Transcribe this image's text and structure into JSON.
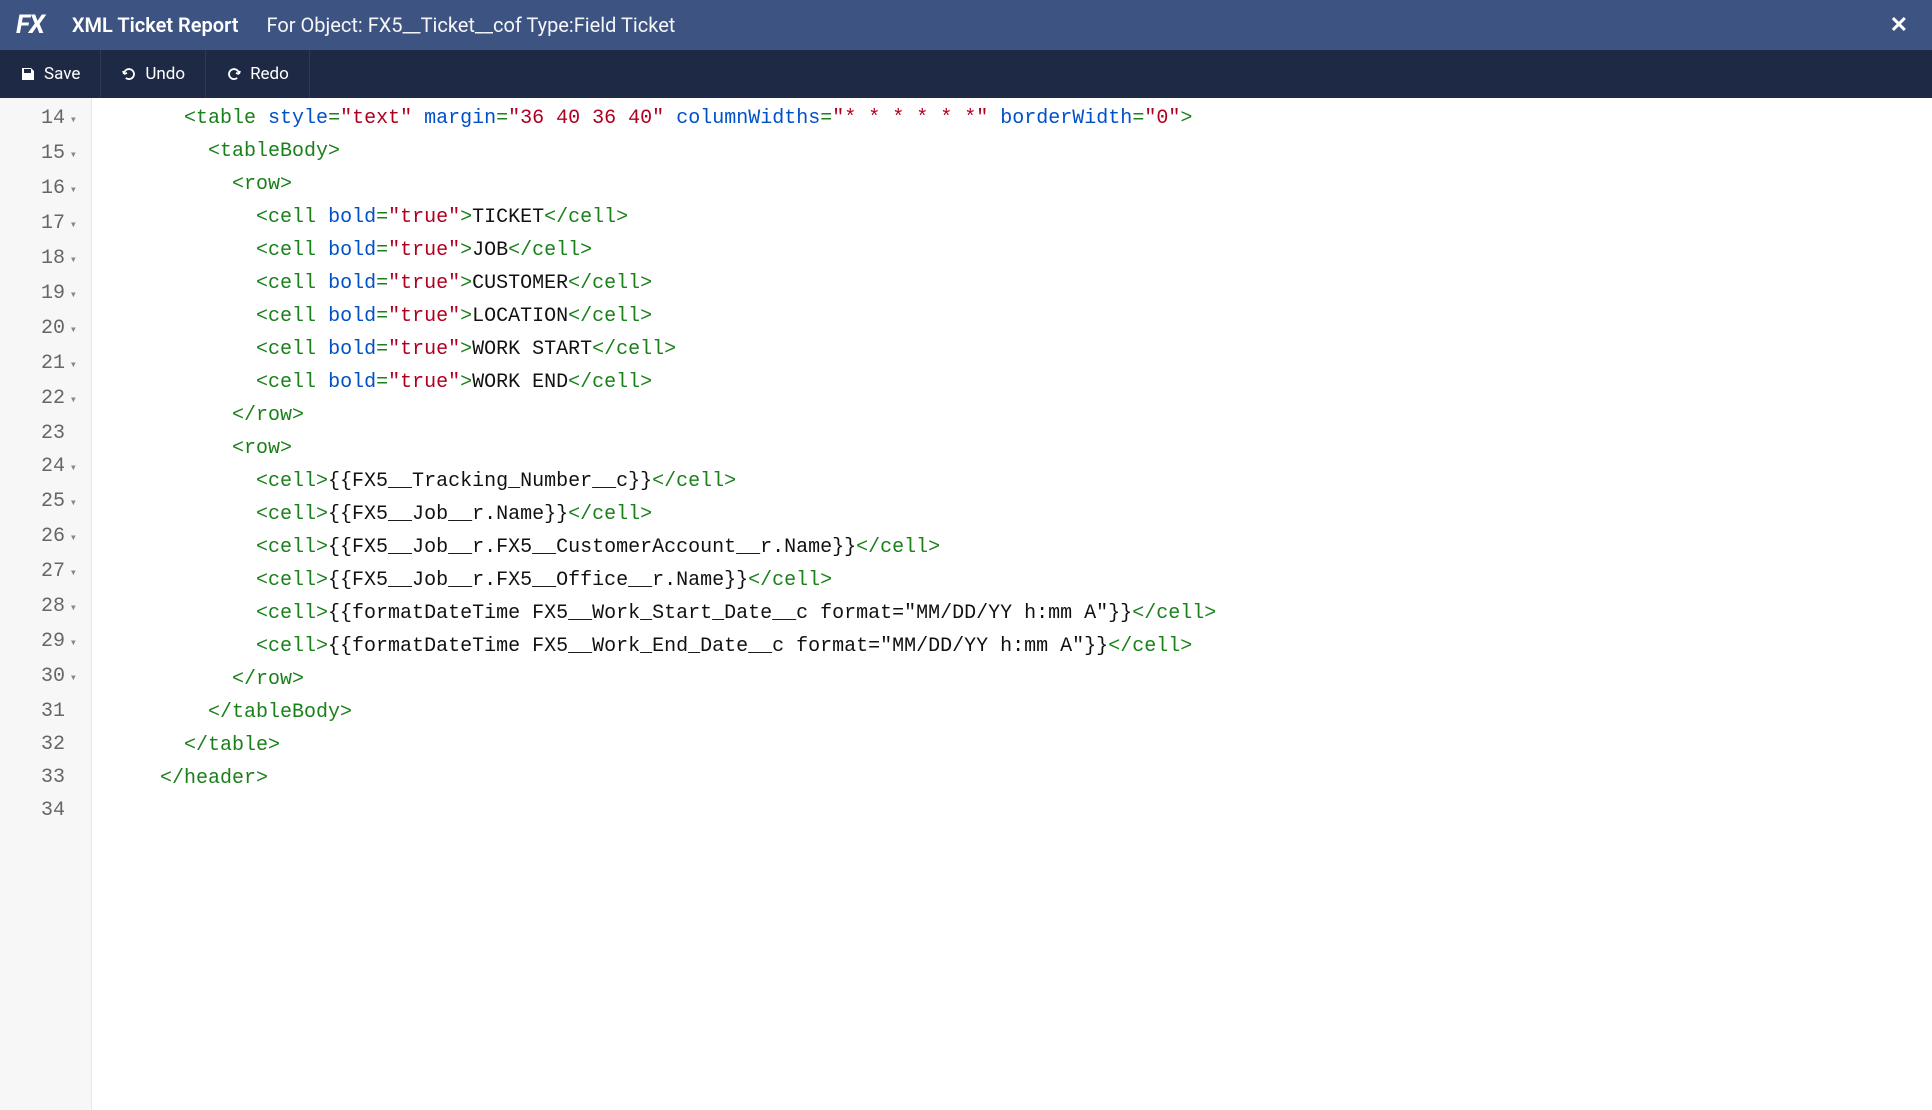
{
  "titlebar": {
    "logo": "FX",
    "title": "XML Ticket Report",
    "subtitle": "For Object: FX5__Ticket__cof Type:Field Ticket"
  },
  "toolbar": {
    "save": "Save",
    "undo": "Undo",
    "redo": "Redo"
  },
  "editor": {
    "startLine": 14,
    "lines": [
      {
        "fold": true,
        "indent": 3,
        "tokens": [
          [
            "tag",
            "<table"
          ],
          [
            "text",
            " "
          ],
          [
            "attr",
            "style"
          ],
          [
            "tag",
            "="
          ],
          [
            "str",
            "\"text\""
          ],
          [
            "text",
            " "
          ],
          [
            "attr",
            "margin"
          ],
          [
            "tag",
            "="
          ],
          [
            "str",
            "\"36 40 36 40\""
          ],
          [
            "text",
            " "
          ],
          [
            "attr",
            "columnWidths"
          ],
          [
            "tag",
            "="
          ],
          [
            "str",
            "\"* * * * * *\""
          ],
          [
            "text",
            " "
          ],
          [
            "attr",
            "borderWidth"
          ],
          [
            "tag",
            "="
          ],
          [
            "str",
            "\"0\""
          ],
          [
            "tag",
            ">"
          ]
        ]
      },
      {
        "fold": true,
        "indent": 4,
        "tokens": [
          [
            "tag",
            "<tableBody>"
          ]
        ]
      },
      {
        "fold": true,
        "indent": 5,
        "tokens": [
          [
            "tag",
            "<row>"
          ]
        ]
      },
      {
        "fold": true,
        "indent": 6,
        "tokens": [
          [
            "tag",
            "<cell"
          ],
          [
            "text",
            " "
          ],
          [
            "attr",
            "bold"
          ],
          [
            "tag",
            "="
          ],
          [
            "str",
            "\"true\""
          ],
          [
            "tag",
            ">"
          ],
          [
            "text",
            "TICKET"
          ],
          [
            "tag",
            "</cell>"
          ]
        ]
      },
      {
        "fold": true,
        "indent": 6,
        "tokens": [
          [
            "tag",
            "<cell"
          ],
          [
            "text",
            " "
          ],
          [
            "attr",
            "bold"
          ],
          [
            "tag",
            "="
          ],
          [
            "str",
            "\"true\""
          ],
          [
            "tag",
            ">"
          ],
          [
            "text",
            "JOB"
          ],
          [
            "tag",
            "</cell>"
          ]
        ]
      },
      {
        "fold": true,
        "indent": 6,
        "tokens": [
          [
            "tag",
            "<cell"
          ],
          [
            "text",
            " "
          ],
          [
            "attr",
            "bold"
          ],
          [
            "tag",
            "="
          ],
          [
            "str",
            "\"true\""
          ],
          [
            "tag",
            ">"
          ],
          [
            "text",
            "CUSTOMER"
          ],
          [
            "tag",
            "</cell>"
          ]
        ]
      },
      {
        "fold": true,
        "indent": 6,
        "tokens": [
          [
            "tag",
            "<cell"
          ],
          [
            "text",
            " "
          ],
          [
            "attr",
            "bold"
          ],
          [
            "tag",
            "="
          ],
          [
            "str",
            "\"true\""
          ],
          [
            "tag",
            ">"
          ],
          [
            "text",
            "LOCATION"
          ],
          [
            "tag",
            "</cell>"
          ]
        ]
      },
      {
        "fold": true,
        "indent": 6,
        "tokens": [
          [
            "tag",
            "<cell"
          ],
          [
            "text",
            " "
          ],
          [
            "attr",
            "bold"
          ],
          [
            "tag",
            "="
          ],
          [
            "str",
            "\"true\""
          ],
          [
            "tag",
            ">"
          ],
          [
            "text",
            "WORK START"
          ],
          [
            "tag",
            "</cell>"
          ]
        ]
      },
      {
        "fold": true,
        "indent": 6,
        "tokens": [
          [
            "tag",
            "<cell"
          ],
          [
            "text",
            " "
          ],
          [
            "attr",
            "bold"
          ],
          [
            "tag",
            "="
          ],
          [
            "str",
            "\"true\""
          ],
          [
            "tag",
            ">"
          ],
          [
            "text",
            "WORK END"
          ],
          [
            "tag",
            "</cell>"
          ]
        ]
      },
      {
        "fold": false,
        "indent": 5,
        "tokens": [
          [
            "tag",
            "</row>"
          ]
        ]
      },
      {
        "fold": true,
        "indent": 5,
        "tokens": [
          [
            "tag",
            "<row>"
          ]
        ]
      },
      {
        "fold": true,
        "indent": 6,
        "tokens": [
          [
            "tag",
            "<cell>"
          ],
          [
            "text",
            "{{FX5__Tracking_Number__c}}"
          ],
          [
            "tag",
            "</cell>"
          ]
        ]
      },
      {
        "fold": true,
        "indent": 6,
        "tokens": [
          [
            "tag",
            "<cell>"
          ],
          [
            "text",
            "{{FX5__Job__r.Name}}"
          ],
          [
            "tag",
            "</cell>"
          ]
        ]
      },
      {
        "fold": true,
        "indent": 6,
        "tokens": [
          [
            "tag",
            "<cell>"
          ],
          [
            "text",
            "{{FX5__Job__r.FX5__CustomerAccount__r.Name}}"
          ],
          [
            "tag",
            "</cell>"
          ]
        ]
      },
      {
        "fold": true,
        "indent": 6,
        "tokens": [
          [
            "tag",
            "<cell>"
          ],
          [
            "text",
            "{{FX5__Job__r.FX5__Office__r.Name}}"
          ],
          [
            "tag",
            "</cell>"
          ]
        ]
      },
      {
        "fold": true,
        "indent": 6,
        "tokens": [
          [
            "tag",
            "<cell>"
          ],
          [
            "text",
            "{{formatDateTime FX5__Work_Start_Date__c format=\"MM/DD/YY h:mm A\"}}"
          ],
          [
            "tag",
            "</cell>"
          ]
        ]
      },
      {
        "fold": true,
        "indent": 6,
        "tokens": [
          [
            "tag",
            "<cell>"
          ],
          [
            "text",
            "{{formatDateTime FX5__Work_End_Date__c format=\"MM/DD/YY h:mm A\"}}"
          ],
          [
            "tag",
            "</cell>"
          ]
        ]
      },
      {
        "fold": false,
        "indent": 5,
        "tokens": [
          [
            "tag",
            "</row>"
          ]
        ]
      },
      {
        "fold": false,
        "indent": 4,
        "tokens": [
          [
            "tag",
            "</tableBody>"
          ]
        ]
      },
      {
        "fold": false,
        "indent": 3,
        "tokens": [
          [
            "tag",
            "</table>"
          ]
        ]
      },
      {
        "fold": false,
        "indent": 2,
        "tokens": [
          [
            "tag",
            "</header>"
          ]
        ]
      }
    ]
  }
}
